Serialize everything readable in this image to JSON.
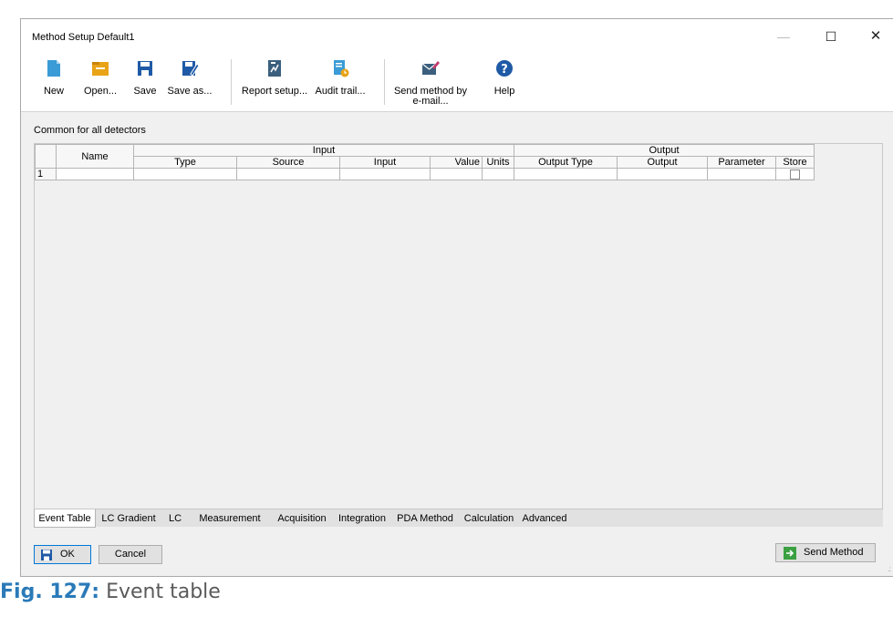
{
  "window": {
    "title": "Method Setup Default1"
  },
  "toolbar": {
    "new": "New",
    "open": "Open...",
    "save": "Save",
    "save_as": "Save as...",
    "report_setup": "Report setup...",
    "audit_trail": "Audit trail...",
    "send_method_line1": "Send method by",
    "send_method_line2": "e-mail...",
    "help": "Help"
  },
  "section_label": "Common for all detectors",
  "table": {
    "group_headers": {
      "name": "Name",
      "input": "Input",
      "output": "Output"
    },
    "columns": {
      "type": "Type",
      "source": "Source",
      "input": "Input",
      "value": "Value",
      "units": "Units",
      "output_type": "Output Type",
      "output": "Output",
      "parameter": "Parameter",
      "store": "Store"
    },
    "rows": [
      {
        "num": "1",
        "store": false
      }
    ]
  },
  "tabs": [
    "Event Table",
    "LC Gradient",
    "LC",
    "Measurement",
    "Acquisition",
    "Integration",
    "PDA Method",
    "Calculation",
    "Advanced"
  ],
  "buttons": {
    "ok": "OK",
    "cancel": "Cancel",
    "send_method": "Send Method"
  },
  "caption": {
    "number": "Fig. 127:",
    "text": "Event table"
  },
  "colors": {
    "accent": "#2a7ab8",
    "save_icon": "#1f5aa6",
    "open_icon": "#e8a317",
    "new_icon": "#3a9bd6",
    "send_icon": "#3aa041"
  }
}
